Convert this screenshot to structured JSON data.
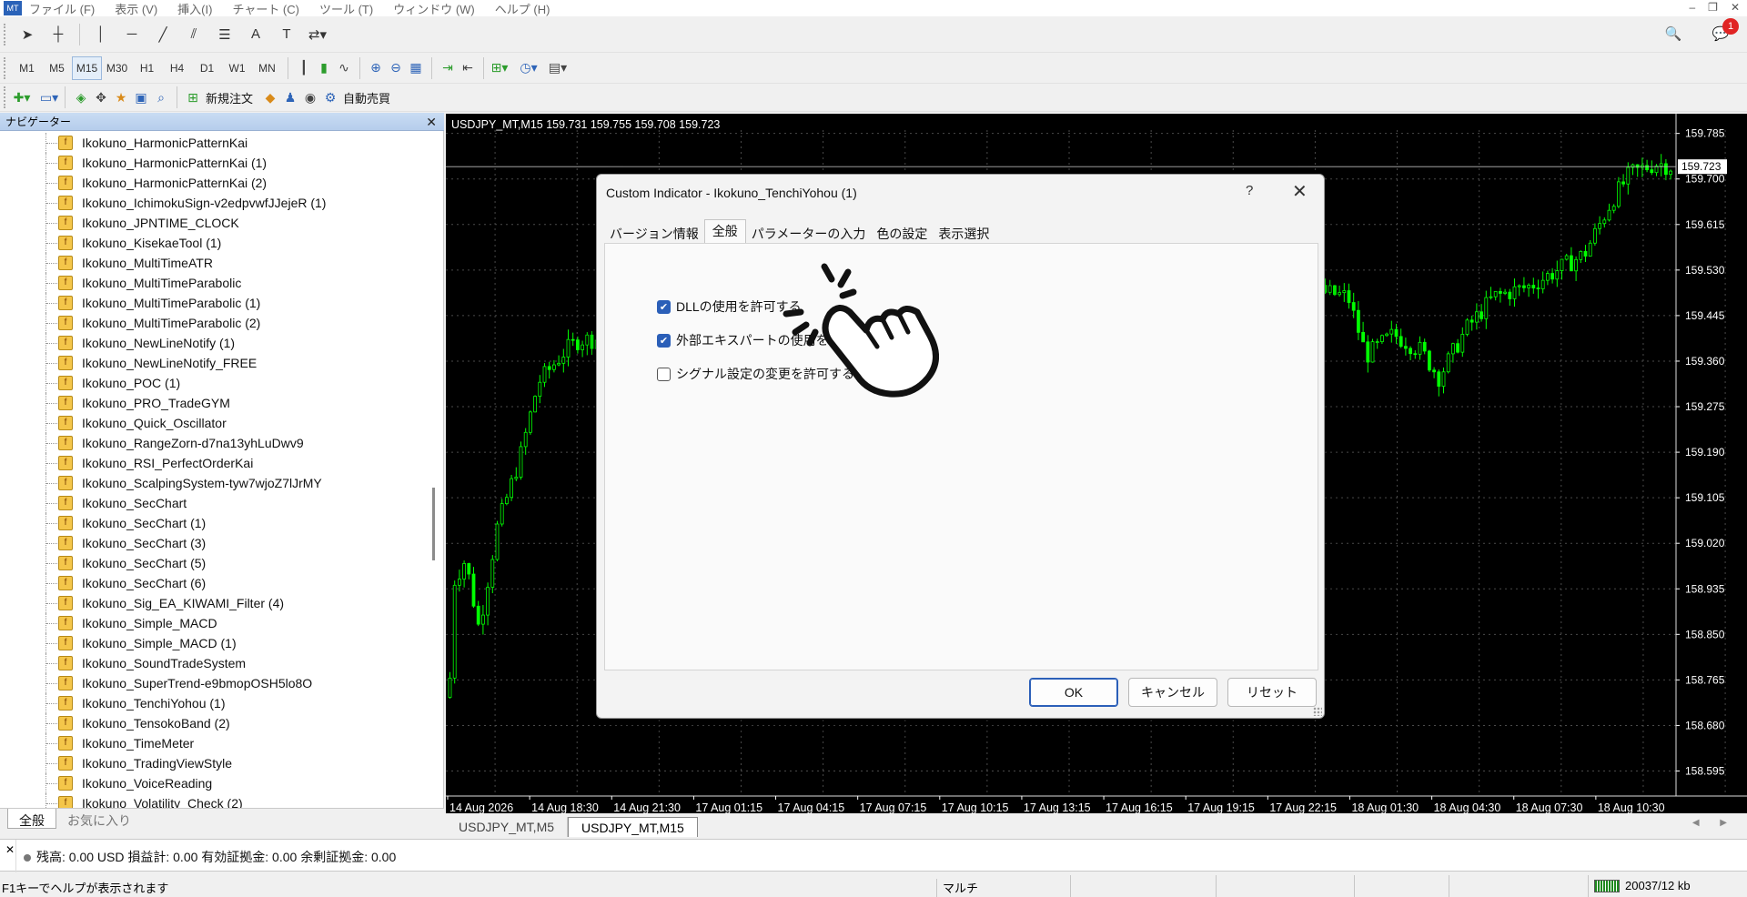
{
  "menubar": {
    "app_icon": "MT",
    "items": [
      "ファイル (F)",
      "表示 (V)",
      "挿入(I)",
      "チャート (C)",
      "ツール (T)",
      "ウィンドウ (W)",
      "ヘルプ (H)"
    ],
    "window_controls": [
      "–",
      "❐",
      "✕"
    ]
  },
  "toolbar": {
    "timeframes": [
      "M1",
      "M5",
      "M15",
      "M30",
      "H1",
      "H4",
      "D1",
      "W1",
      "MN"
    ],
    "active_timeframe": "M15",
    "new_order_label": "新規注文",
    "auto_trade_label": "自動売買",
    "notification_count": "1"
  },
  "navigator": {
    "title": "ナビゲーター",
    "close": "✕",
    "items": [
      "Ikokuno_HarmonicPatternKai",
      "Ikokuno_HarmonicPatternKai (1)",
      "Ikokuno_HarmonicPatternKai (2)",
      "Ikokuno_IchimokuSign-v2edpvwfJJejeR (1)",
      "Ikokuno_JPNTIME_CLOCK",
      "Ikokuno_KisekaeTool (1)",
      "Ikokuno_MultiTimeATR",
      "Ikokuno_MultiTimeParabolic",
      "Ikokuno_MultiTimeParabolic (1)",
      "Ikokuno_MultiTimeParabolic (2)",
      "Ikokuno_NewLineNotify (1)",
      "Ikokuno_NewLineNotify_FREE",
      "Ikokuno_POC (1)",
      "Ikokuno_PRO_TradeGYM",
      "Ikokuno_Quick_Oscillator",
      "Ikokuno_RangeZorn-d7na13yhLuDwv9",
      "Ikokuno_RSI_PerfectOrderKai",
      "Ikokuno_ScalpingSystem-tyw7wjoZ7lJrMY",
      "Ikokuno_SecChart",
      "Ikokuno_SecChart (1)",
      "Ikokuno_SecChart (3)",
      "Ikokuno_SecChart (5)",
      "Ikokuno_SecChart (6)",
      "Ikokuno_Sig_EA_KIWAMI_Filter (4)",
      "Ikokuno_Simple_MACD",
      "Ikokuno_Simple_MACD (1)",
      "Ikokuno_SoundTradeSystem",
      "Ikokuno_SuperTrend-e9bmopOSH5lo8O",
      "Ikokuno_TenchiYohou (1)",
      "Ikokuno_TensokoBand (2)",
      "Ikokuno_TimeMeter",
      "Ikokuno_TradingViewStyle",
      "Ikokuno_VoiceReading",
      "Ikokuno_Volatility_Check (2)"
    ],
    "tabs": [
      "全般",
      "お気に入り"
    ]
  },
  "chart": {
    "header": "USDJPY_MT,M15  159.731 159.755 159.708 159.723",
    "current_price": "159.723",
    "price_labels": [
      "159.785",
      "159.700",
      "159.615",
      "159.530",
      "159.445",
      "159.360",
      "159.275",
      "159.190",
      "159.105",
      "159.020",
      "158.935",
      "158.850",
      "158.765",
      "158.680",
      "158.595"
    ],
    "time_labels": [
      "14 Aug 2026",
      "14 Aug 18:30",
      "14 Aug 21:30",
      "17 Aug 01:15",
      "17 Aug 04:15",
      "17 Aug 07:15",
      "17 Aug 10:15",
      "17 Aug 13:15",
      "17 Aug 16:15",
      "17 Aug 19:15",
      "17 Aug 22:15",
      "18 Aug 01:30",
      "18 Aug 04:30",
      "18 Aug 07:30",
      "18 Aug 10:30"
    ],
    "tabs": [
      "USDJPY_MT,M5",
      "USDJPY_MT,M15"
    ],
    "active_tab": "USDJPY_MT,M15",
    "bull_color": "#ffffff",
    "bear_color": "#00ff00",
    "grid_color": "#4a4a4a"
  },
  "terminal": {
    "close": "✕",
    "summary": "残高: 0.00 USD  損益計: 0.00  有効証拠金: 0.00  余剰証拠金: 0.00"
  },
  "statusbar": {
    "help": "F1キーでヘルプが表示されます",
    "profile": "マルチ",
    "traffic": "20037/12 kb"
  },
  "dialog": {
    "title": "Custom Indicator - Ikokuno_TenchiYohou (1)",
    "help": "?",
    "close": "✕",
    "tabs": [
      "バージョン情報",
      "全般",
      "パラメーターの入力",
      "色の設定",
      "表示選択"
    ],
    "active_tab": "全般",
    "options": [
      {
        "label": "DLLの使用を許可する",
        "checked": true
      },
      {
        "label": "外部エキスパートの使用を許可する",
        "checked": true
      },
      {
        "label": "シグナル設定の変更を許可する",
        "checked": false
      }
    ],
    "buttons": {
      "ok": "OK",
      "cancel": "キャンセル",
      "reset": "リセット"
    }
  }
}
